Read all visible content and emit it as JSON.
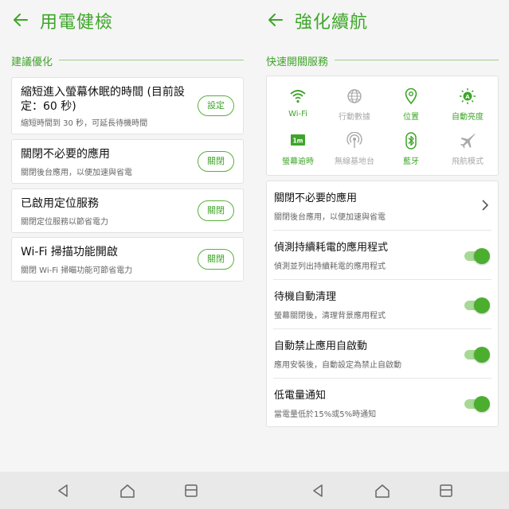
{
  "colors": {
    "accent": "#3fa52a",
    "toggle_on": "#4cae2f",
    "disabled": "#a9a9a9"
  },
  "left": {
    "title": "用電健檢",
    "section_label": "建議優化",
    "cards": [
      {
        "title": "縮短進入螢幕休眠的時間 (目前設定：60 秒)",
        "desc": "縮短時間到 30 秒，可延長待機時間",
        "button": "設定"
      },
      {
        "title": "關閉不必要的應用",
        "desc": "關閉後台應用，以便加速與省電",
        "button": "關閉"
      },
      {
        "title": "已啟用定位服務",
        "desc": "關閉定位服務以節省電力",
        "button": "關閉"
      },
      {
        "title": "Wi-Fi 掃描功能開啟",
        "desc": "關閉 Wi-Fi 掃瞄功能可節省電力",
        "button": "關閉"
      }
    ]
  },
  "right": {
    "title": "強化續航",
    "section_label": "快速開關服務",
    "quick_toggles": [
      {
        "label": "Wi-Fi",
        "icon": "wifi-icon",
        "state": "on"
      },
      {
        "label": "行動數據",
        "icon": "globe-icon",
        "state": "off"
      },
      {
        "label": "位置",
        "icon": "location-pin-icon",
        "state": "on"
      },
      {
        "label": "自動亮度",
        "icon": "auto-brightness-icon",
        "state": "on"
      },
      {
        "label": "螢幕逾時",
        "icon": "screen-timeout-icon",
        "badge": "1m",
        "state": "on"
      },
      {
        "label": "無線基地台",
        "icon": "hotspot-icon",
        "state": "off"
      },
      {
        "label": "藍牙",
        "icon": "bluetooth-icon",
        "state": "on"
      },
      {
        "label": "飛航模式",
        "icon": "airplane-icon",
        "state": "off"
      }
    ],
    "settings": [
      {
        "title": "關閉不必要的應用",
        "desc": "關閉後台應用，以便加速與省電",
        "control": "chevron"
      },
      {
        "title": "偵測持續耗電的應用程式",
        "desc": "偵測並列出持續耗電的應用程式",
        "control": "toggle",
        "on": true
      },
      {
        "title": "待機自動清理",
        "desc": "螢幕關閉後，清理背景應用程式",
        "control": "toggle",
        "on": true
      },
      {
        "title": "自動禁止應用自啟動",
        "desc": "應用安裝後，自動設定為禁止自啟動",
        "control": "toggle",
        "on": true
      },
      {
        "title": "低電量通知",
        "desc": "當電量低於15%或5%時通知",
        "control": "toggle",
        "on": true
      }
    ]
  },
  "navbar": {
    "buttons": [
      "back-nav-icon",
      "home-nav-icon",
      "recents-nav-icon"
    ]
  }
}
